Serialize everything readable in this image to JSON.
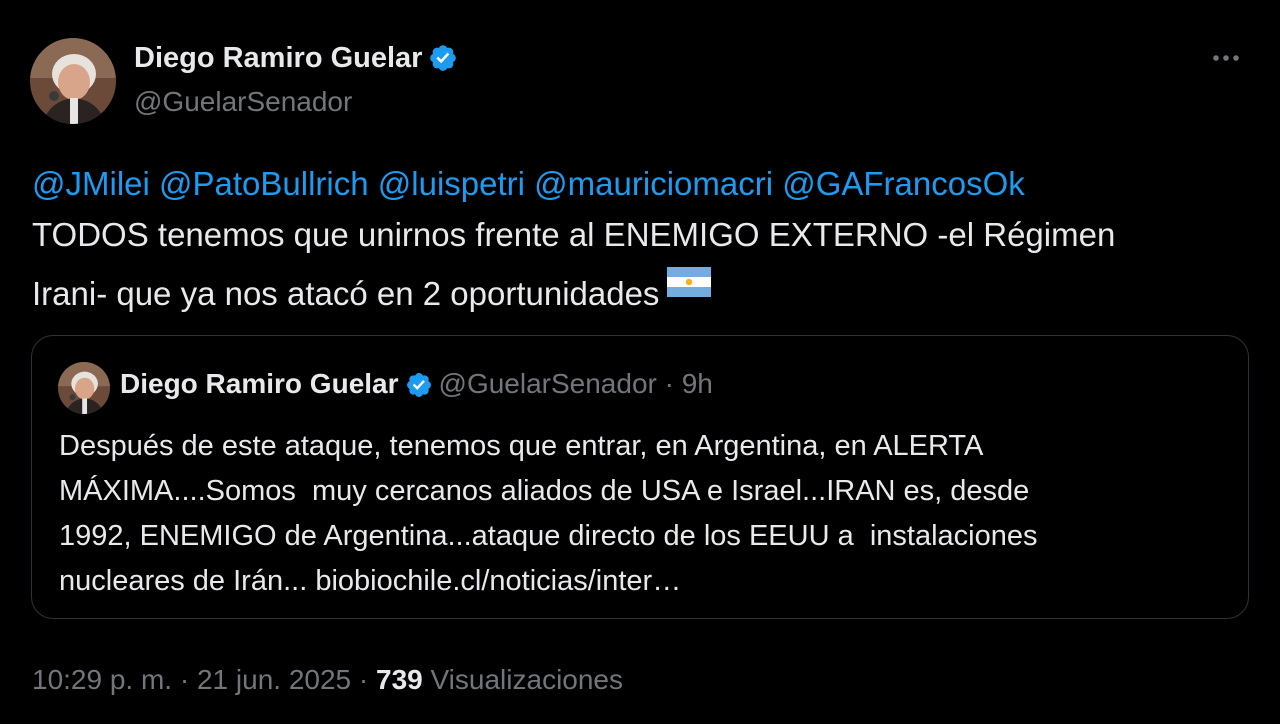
{
  "tweet": {
    "author": {
      "name": "Diego Ramiro Guelar",
      "handle": "@GuelarSenador",
      "verified": true
    },
    "more_icon": "more-horizontal-icon",
    "mentions": [
      "@JMilei",
      "@PatoBullrich",
      "@luispetri",
      "@mauriciomacri",
      "@GAFrancosOk"
    ],
    "text_line_2": "TODOS tenemos que unirnos frente al ENEMIGO EXTERNO -el Régimen",
    "text_line_3": "Irani- que ya nos atacó en 2 oportunidades",
    "emoji": "argentina-flag-emoji",
    "quoted": {
      "author_name": "Diego Ramiro Guelar",
      "author_handle": "@GuelarSenador",
      "separator": "·",
      "time": "9h",
      "lines": [
        "Después de este ataque, tenemos que entrar, en Argentina, en ALERTA",
        "MÁXIMA....Somos  muy cercanos aliados de USA e Israel...IRAN es, desde",
        "1992, ENEMIGO de Argentina...ataque directo de los EEUU a  instalaciones",
        "nucleares de Irán... biobiochile.cl/noticias/inter…"
      ]
    },
    "meta": {
      "time": "10:29 p. m.",
      "date": "21 jun. 2025",
      "separator": "·",
      "views_count": "739",
      "views_label": "Visualizaciones"
    }
  },
  "colors": {
    "background": "#000000",
    "text": "#e7e9ea",
    "secondary": "#71767b",
    "link": "#1d9bf0",
    "border": "#2f3336",
    "verified": "#1d9bf0"
  }
}
